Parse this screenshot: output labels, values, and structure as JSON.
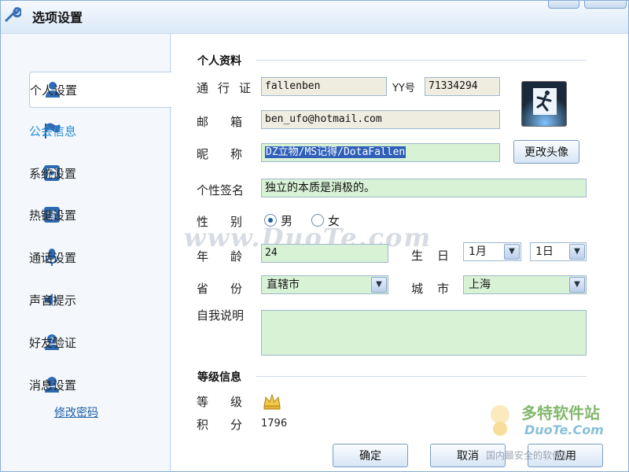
{
  "window": {
    "title": "选项设置"
  },
  "sidebar": {
    "items": [
      {
        "label": "个人设置",
        "icon": "user-icon",
        "active": true
      },
      {
        "label": "公会信息",
        "icon": "guild-flag-icon",
        "active": false
      },
      {
        "label": "系统设置",
        "icon": "system-settings-icon",
        "active": false
      },
      {
        "label": "热键设置",
        "icon": "hotkey-icon",
        "active": false
      },
      {
        "label": "通话设置",
        "icon": "microphone-icon",
        "active": false
      },
      {
        "label": "声音提示",
        "icon": "speaker-icon",
        "active": false
      },
      {
        "label": "好友验证",
        "icon": "friend-verify-icon",
        "active": false
      },
      {
        "label": "消息设置",
        "icon": "message-user-icon",
        "active": false
      }
    ],
    "change_password": "修改密码"
  },
  "profile": {
    "section_title": "个人资料",
    "passport_label": "通行证",
    "passport_value": "fallenben",
    "yy_label": "YY号",
    "yy_value": "71334294",
    "email_label": "邮箱",
    "email_value": "ben_ufo@hotmail.com",
    "nickname_label": "昵称",
    "nickname_value": "DZ立物/MS记得/DotaFallen",
    "change_avatar": "更改头像",
    "signature_label": "个性签名",
    "signature_value": "独立的本质是消极的。",
    "gender_label": "性别",
    "gender_male": "男",
    "gender_female": "女",
    "age_label": "年龄",
    "age_value": "24",
    "birthday_label": "生日",
    "birth_month": "1月",
    "birth_day": "1日",
    "province_label": "省份",
    "province_value": "直辖市",
    "city_label": "城市",
    "city_value": "上海",
    "about_label": "自我说明",
    "about_value": ""
  },
  "level": {
    "section_title": "等级信息",
    "level_label": "等级",
    "points_label": "积分",
    "points_value": "1796"
  },
  "buttons": {
    "ok": "确定",
    "cancel": "取消",
    "apply": "应用"
  },
  "watermarks": {
    "main": "www.DuoTe.com",
    "logo": "多特软件站",
    "logo_sub": "DuoTe.Com",
    "footer": "国内最安全的软件站"
  },
  "colors": {
    "accent": "#2a8fd8",
    "field_beige": "#efece0",
    "field_green": "#d8f2d5"
  }
}
